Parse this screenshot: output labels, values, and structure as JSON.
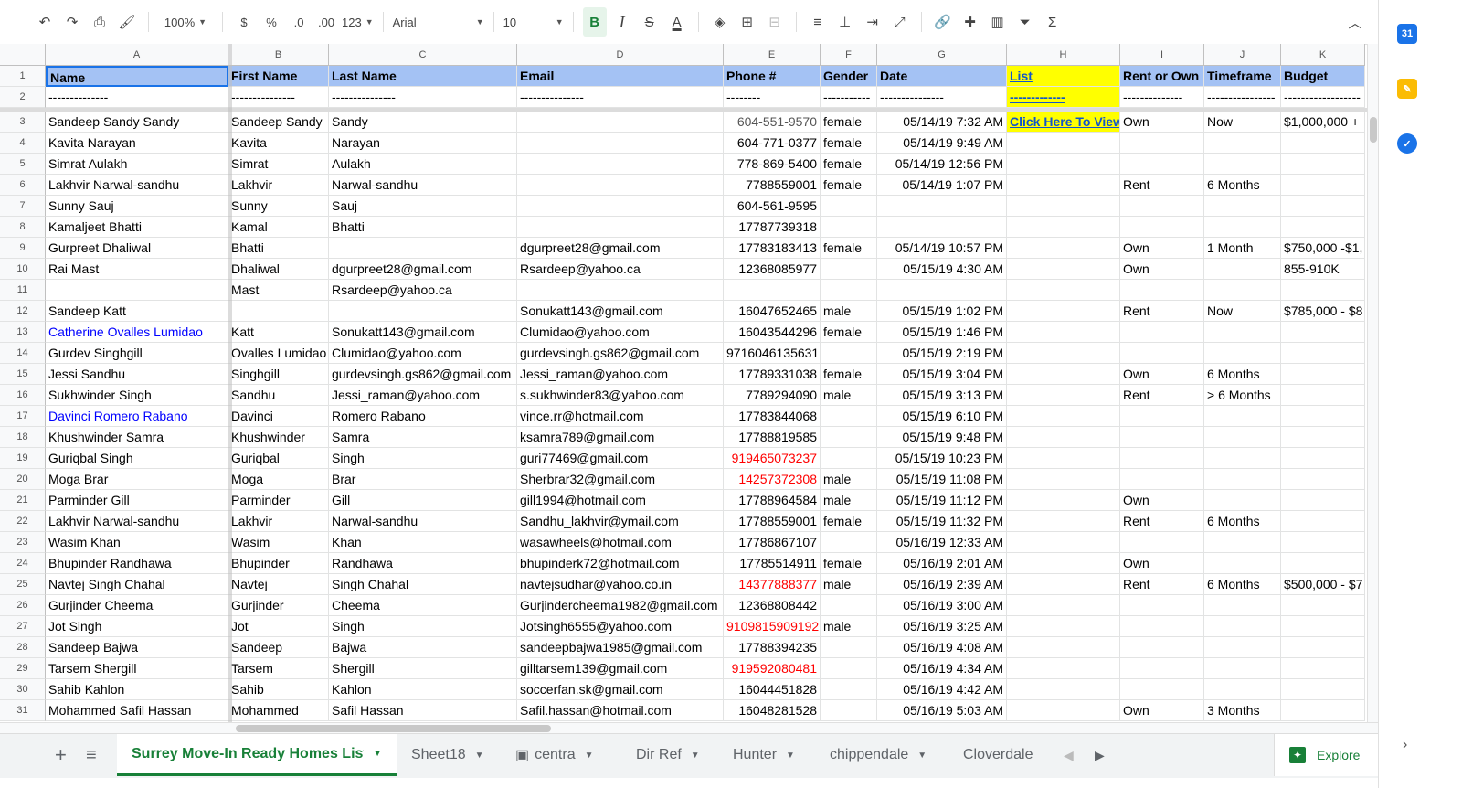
{
  "toolbar": {
    "undo_icon": "undo-icon",
    "redo_icon": "redo-icon",
    "print_icon": "print-icon",
    "paint_format_icon": "paint-format-icon",
    "zoom": "100%",
    "currency": "$",
    "percent": "%",
    "dec_less": ".0",
    "dec_more": ".00",
    "more_formats": "123",
    "font": "Arial",
    "font_size": "10",
    "bold": "B",
    "italic": "I",
    "strike": "S",
    "text_color": "A"
  },
  "columns": [
    {
      "letter": "A"
    },
    {
      "letter": "B"
    },
    {
      "letter": "C"
    },
    {
      "letter": "D"
    },
    {
      "letter": "E"
    },
    {
      "letter": "F"
    },
    {
      "letter": "G"
    },
    {
      "letter": "H"
    },
    {
      "letter": "I"
    },
    {
      "letter": "J"
    },
    {
      "letter": "K"
    }
  ],
  "rows": [
    {
      "num": "1",
      "cells": [
        "Name",
        "First Name",
        "Last Name",
        "Email",
        "Phone #",
        "Gender",
        "Date",
        "List",
        "Rent or Own",
        "Timeframe",
        "Budget"
      ]
    },
    {
      "num": "2",
      "cells": [
        "--------------",
        "---------------",
        "---------------",
        "---------------",
        "--------",
        "-----------",
        "---------------",
        "-------------",
        "--------------",
        "----------------",
        "------------------"
      ]
    },
    {
      "num": "3",
      "cells": [
        "Sandeep Sandy Sandy",
        "Sandeep Sandy",
        "Sandy",
        "",
        "604-551-9570",
        "female",
        "05/14/19 7:32 AM",
        "Click Here To View",
        "Own",
        "Now",
        "$1,000,000 +"
      ]
    },
    {
      "num": "4",
      "cells": [
        "Kavita Narayan",
        "Kavita",
        "Narayan",
        "",
        "604-771-0377",
        "female",
        "05/14/19 9:49 AM",
        "",
        "",
        "",
        ""
      ]
    },
    {
      "num": "5",
      "cells": [
        "Simrat Aulakh",
        "Simrat",
        "Aulakh",
        "",
        "778-869-5400",
        "female",
        "05/14/19 12:56 PM",
        "",
        "",
        "",
        ""
      ]
    },
    {
      "num": "6",
      "cells": [
        "Lakhvir Narwal-sandhu",
        "Lakhvir",
        "Narwal-sandhu",
        "",
        "7788559001",
        "female",
        "05/14/19 1:07 PM",
        "",
        "Rent",
        "6 Months",
        ""
      ]
    },
    {
      "num": "7",
      "cells": [
        " Sunny Sauj",
        "Sunny",
        "Sauj",
        "",
        "604-561-9595",
        "",
        "",
        "",
        "",
        "",
        ""
      ]
    },
    {
      "num": "8",
      "cells": [
        "Kamaljeet Bhatti",
        "Kamal",
        "Bhatti",
        "",
        "17787739318",
        "",
        "",
        "",
        "",
        "",
        ""
      ]
    },
    {
      "num": "9",
      "cells": [
        "Gurpreet Dhaliwal",
        "Bhatti",
        "",
        "dgurpreet28@gmail.com",
        "17783183413",
        "female",
        "05/14/19 10:57 PM",
        "",
        "Own",
        "1 Month",
        "$750,000 -$1,"
      ]
    },
    {
      "num": "10",
      "cells": [
        "Rai Mast",
        "Dhaliwal",
        "dgurpreet28@gmail.com",
        "Rsardeep@yahoo.ca",
        "12368085977",
        "",
        "05/15/19 4:30 AM",
        "",
        "Own",
        "",
        "855-910K"
      ]
    },
    {
      "num": "11",
      "cells": [
        "",
        "Mast",
        "Rsardeep@yahoo.ca",
        "",
        "",
        "",
        "",
        "",
        "",
        "",
        ""
      ]
    },
    {
      "num": "12",
      "cells": [
        "Sandeep Katt",
        "",
        "",
        "Sonukatt143@gmail.com",
        "16047652465",
        "male",
        "05/15/19 1:02 PM",
        "",
        "Rent",
        "Now",
        "$785,000 - $8"
      ]
    },
    {
      "num": "13",
      "cells": [
        "Catherine Ovalles Lumidao",
        "Katt",
        "Sonukatt143@gmail.com",
        "Clumidao@yahoo.com",
        "16043544296",
        "female",
        "05/15/19 1:46 PM",
        "",
        "",
        "",
        ""
      ]
    },
    {
      "num": "14",
      "cells": [
        "Gurdev Singhgill",
        "Ovalles Lumidao",
        "Clumidao@yahoo.com",
        "gurdevsingh.gs862@gmail.com",
        "9716046135631",
        "",
        "05/15/19 2:19 PM",
        "",
        "",
        "",
        ""
      ]
    },
    {
      "num": "15",
      "cells": [
        "Jessi Sandhu",
        "Singhgill",
        "gurdevsingh.gs862@gmail.com",
        "Jessi_raman@yahoo.com",
        "17789331038",
        "female",
        "05/15/19 3:04 PM",
        "",
        "Own",
        "6 Months",
        ""
      ]
    },
    {
      "num": "16",
      "cells": [
        "Sukhwinder Singh",
        "Sandhu",
        "Jessi_raman@yahoo.com",
        "s.sukhwinder83@yahoo.com",
        "7789294090",
        "male",
        "05/15/19 3:13 PM",
        "",
        "Rent",
        "> 6 Months",
        ""
      ]
    },
    {
      "num": "17",
      "cells": [
        "Davinci Romero Rabano",
        "Davinci",
        "Romero Rabano",
        "vince.rr@hotmail.com",
        "17783844068",
        "",
        "05/15/19 6:10 PM",
        "",
        "",
        "",
        ""
      ]
    },
    {
      "num": "18",
      "cells": [
        "Khushwinder Samra",
        "Khushwinder",
        "Samra",
        "ksamra789@gmail.com",
        "17788819585",
        "",
        "05/15/19 9:48 PM",
        "",
        "",
        "",
        ""
      ]
    },
    {
      "num": "19",
      "cells": [
        "Guriqbal Singh",
        "Guriqbal",
        "Singh",
        "guri77469@gmail.com",
        "919465073237",
        "",
        "05/15/19 10:23 PM",
        "",
        "",
        "",
        ""
      ]
    },
    {
      "num": "20",
      "cells": [
        "Moga Brar",
        "Moga",
        "Brar",
        "Sherbrar32@gmail.com",
        "14257372308",
        "male",
        "05/15/19 11:08 PM",
        "",
        "",
        "",
        ""
      ]
    },
    {
      "num": "21",
      "cells": [
        "Parminder Gill",
        "Parminder",
        "Gill",
        "gill1994@hotmail.com",
        "17788964584",
        "male",
        "05/15/19 11:12 PM",
        "",
        "Own",
        "",
        ""
      ]
    },
    {
      "num": "22",
      "cells": [
        "Lakhvir Narwal-sandhu",
        "Lakhvir",
        "Narwal-sandhu",
        "Sandhu_lakhvir@ymail.com",
        "17788559001",
        "female",
        "05/15/19 11:32 PM",
        "",
        "Rent",
        "6 Months",
        ""
      ]
    },
    {
      "num": "23",
      "cells": [
        "Wasim Khan",
        "Wasim",
        "Khan",
        "wasawheels@hotmail.com",
        "17786867107",
        "",
        "05/16/19 12:33 AM",
        "",
        "",
        "",
        ""
      ]
    },
    {
      "num": "24",
      "cells": [
        "Bhupinder Randhawa",
        "Bhupinder",
        "Randhawa",
        "bhupinderk72@hotmail.com",
        "17785514911",
        "female",
        "05/16/19 2:01 AM",
        "",
        "Own",
        "",
        ""
      ]
    },
    {
      "num": "25",
      "cells": [
        "Navtej Singh Chahal",
        "Navtej",
        "Singh Chahal",
        "navtejsudhar@yahoo.co.in",
        "14377888377",
        "male",
        "05/16/19 2:39 AM",
        "",
        "Rent",
        "6 Months",
        "$500,000 - $7"
      ]
    },
    {
      "num": "26",
      "cells": [
        "Gurjinder Cheema",
        "Gurjinder",
        "Cheema",
        "Gurjindercheema1982@gmail.com",
        "12368808442",
        "",
        "05/16/19 3:00 AM",
        "",
        "",
        "",
        ""
      ]
    },
    {
      "num": "27",
      "cells": [
        "Jot Singh",
        "Jot",
        "Singh",
        "Jotsingh6555@yahoo.com",
        "9109815909192",
        "male",
        "05/16/19 3:25 AM",
        "",
        "",
        "",
        ""
      ]
    },
    {
      "num": "28",
      "cells": [
        "Sandeep Bajwa",
        "Sandeep",
        "Bajwa",
        "sandeepbajwa1985@gmail.com",
        "17788394235",
        "",
        "05/16/19 4:08 AM",
        "",
        "",
        "",
        ""
      ]
    },
    {
      "num": "29",
      "cells": [
        "Tarsem Shergill",
        "Tarsem",
        "Shergill",
        "gilltarsem139@gmail.com",
        "919592080481",
        "",
        "05/16/19 4:34 AM",
        "",
        "",
        "",
        ""
      ]
    },
    {
      "num": "30",
      "cells": [
        "Sahib Kahlon",
        "Sahib",
        "Kahlon",
        "soccerfan.sk@gmail.com",
        "16044451828",
        "",
        "05/16/19 4:42 AM",
        "",
        "",
        "",
        ""
      ]
    },
    {
      "num": "31",
      "cells": [
        "Mohammed Safil Hassan",
        "Mohammed",
        "Safil Hassan",
        "Safil.hassan@hotmail.com",
        "16048281528",
        "",
        "05/16/19 5:03 AM",
        "",
        "Own",
        "3 Months",
        ""
      ]
    }
  ],
  "red_phone_rows": [
    "19",
    "20",
    "25",
    "27",
    "29"
  ],
  "blue_name_rows": [
    "13",
    "17"
  ],
  "colors": {
    "header_fill": "#a4c2f4",
    "link_fill": "#ffff00",
    "link_text": "#1155cc",
    "red": "#ff0000",
    "blue": "#0000ff",
    "tab_green": "#188038"
  },
  "sheet_tabs": [
    "Surrey Move-In Ready Homes List",
    "Sheet18",
    "centra",
    "Dir Ref",
    "Hunter",
    "chippendale",
    "Cloverdale H"
  ],
  "explore_label": "Explore"
}
